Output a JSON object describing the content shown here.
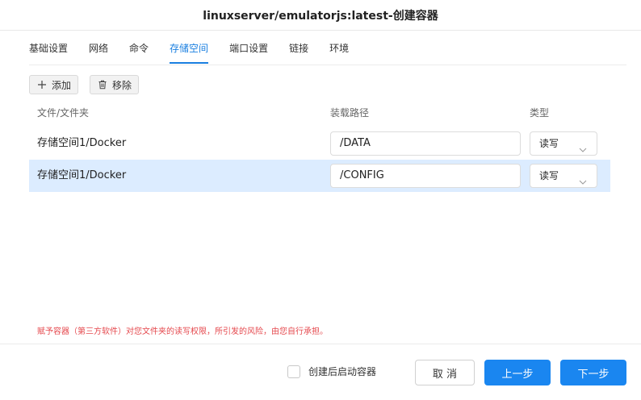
{
  "window": {
    "title": "linuxserver/emulatorjs:latest-创建容器"
  },
  "tabs": [
    {
      "label": "基础设置"
    },
    {
      "label": "网络"
    },
    {
      "label": "命令"
    },
    {
      "label": "存储空间",
      "active": true
    },
    {
      "label": "端口设置"
    },
    {
      "label": "链接"
    },
    {
      "label": "环境"
    }
  ],
  "toolbar": {
    "add_label": "添加",
    "remove_label": "移除",
    "add_icon": "plus-icon",
    "remove_icon": "trash-icon"
  },
  "table": {
    "headers": {
      "path": "文件/文件夹",
      "mount": "装载路径",
      "type": "类型"
    },
    "rows": [
      {
        "path": "存储空间1/Docker",
        "mount": "/DATA",
        "type": "读写",
        "selected": false
      },
      {
        "path": "存储空间1/Docker",
        "mount": "/CONFIG",
        "type": "读写",
        "selected": true
      }
    ]
  },
  "warning": "赋予容器（第三方软件）对您文件夹的读写权限，所引发的风险，由您自行承担。",
  "footer": {
    "auto_start_label": "创建后启动容器",
    "auto_start_checked": false,
    "cancel_label": "取 消",
    "prev_label": "上一步",
    "next_label": "下一步"
  },
  "colors": {
    "accent": "#1a86f0",
    "selected_row": "#dcecff",
    "warning": "#e5484d"
  }
}
